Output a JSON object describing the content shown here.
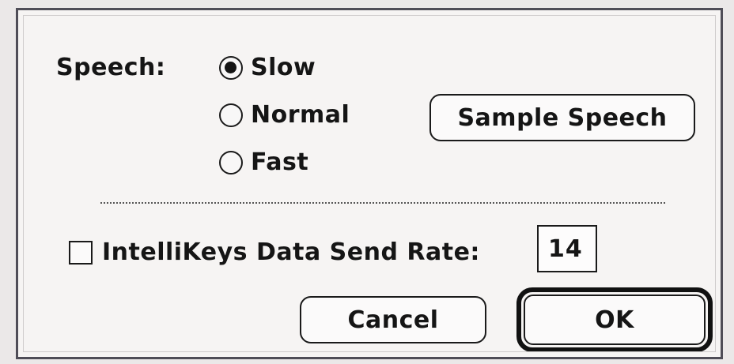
{
  "dialog": {
    "speech": {
      "label": "Speech:",
      "options": [
        {
          "label": "Slow",
          "checked": true
        },
        {
          "label": "Normal",
          "checked": false
        },
        {
          "label": "Fast",
          "checked": false
        }
      ]
    },
    "sample_speech_label": "Sample Speech",
    "send_rate": {
      "checkbox_label": "IntelliKeys Data Send Rate:",
      "checked": false,
      "value": "14"
    },
    "cancel_label": "Cancel",
    "ok_label": "OK"
  },
  "colors": {
    "background": "#f6f4f3",
    "border": "#4f4d57",
    "text": "#151515"
  }
}
